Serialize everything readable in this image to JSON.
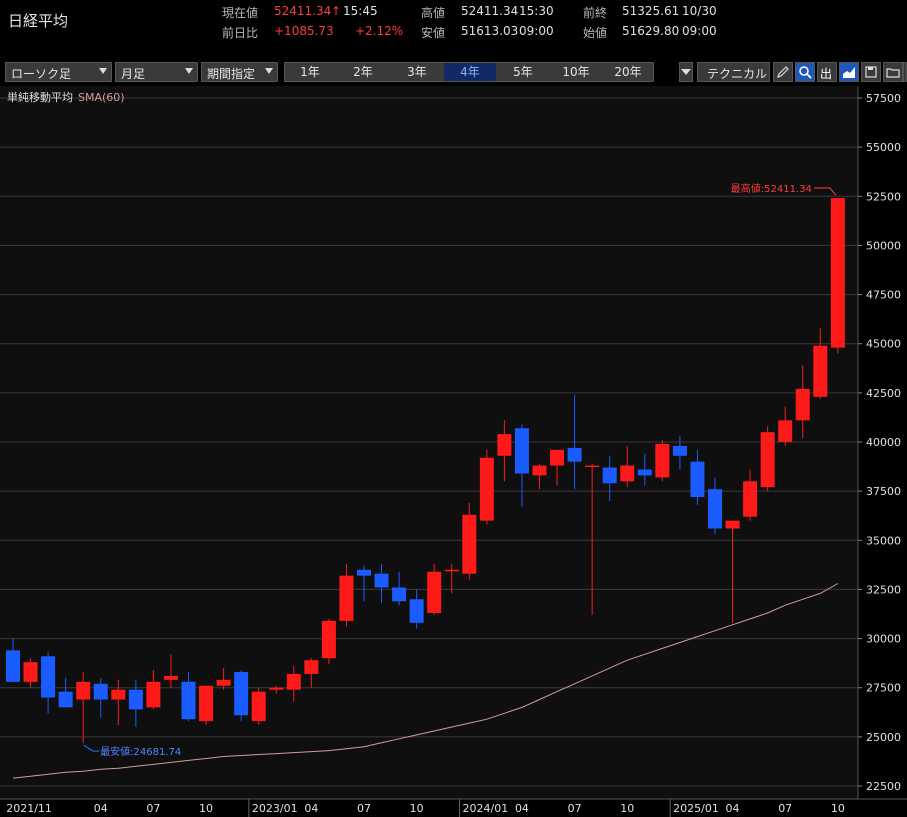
{
  "header": {
    "title": "日経平均",
    "current_label": "現在値",
    "current_value": "52411.34",
    "current_arrow": "↑",
    "current_time": "15:45",
    "high_label": "高値",
    "high_value": "52411.34",
    "high_time": "15:30",
    "prev_close_label": "前終",
    "prev_close_value": "51325.61",
    "prev_close_date": "10/30",
    "change_label": "前日比",
    "change_value": "+1085.73",
    "change_pct": "+2.12%",
    "low_label": "安値",
    "low_value": "51613.03",
    "low_time": "09:00",
    "open_label": "始値",
    "open_value": "51629.80",
    "open_time": "09:00"
  },
  "toolbar": {
    "chart_type": "ローソク足",
    "interval": "月足",
    "period_select": "期間指定",
    "periods": [
      "1年",
      "2年",
      "3年",
      "4年",
      "5年",
      "10年",
      "20年"
    ],
    "active_period": "4年",
    "technical": "テクニカル",
    "out_label": "出",
    "icons": [
      "dropdown-icon",
      "pencil-icon",
      "zoom-icon",
      "output-icon",
      "area-chart-icon",
      "save-icon",
      "folder-icon",
      "new-window-icon"
    ]
  },
  "colors": {
    "up": "#ff1a1a",
    "down": "#1a5cff",
    "sma": "#d89a9a",
    "grid": "#3a3a3a",
    "accent": "#1f58b8"
  },
  "chart_data": {
    "type": "candlestick",
    "indicator_label": "単純移動平均",
    "sma_label": "SMA(60)",
    "ylim": [
      22500,
      57500
    ],
    "y_ticks": [
      22500,
      25000,
      27500,
      30000,
      32500,
      35000,
      37500,
      40000,
      42500,
      45000,
      47500,
      50000,
      52500,
      55000,
      57500
    ],
    "x_labels": [
      "2021/11",
      "04",
      "07",
      "10",
      "2023/01",
      "04",
      "07",
      "10",
      "2024/01",
      "04",
      "07",
      "10",
      "2025/01",
      "04",
      "07",
      "10"
    ],
    "x_label_index": [
      0,
      5,
      8,
      11,
      14,
      17,
      20,
      23,
      26,
      29,
      32,
      35,
      38,
      41,
      44,
      47
    ],
    "max_annotation": "最高値:52411.34",
    "max_index": 47,
    "max_value": 52411.34,
    "min_annotation": "最安値:24681.74",
    "min_index": 4,
    "min_value": 24681.74,
    "candles": [
      {
        "o": 29400,
        "h": 30000,
        "l": 27800,
        "c": 27800
      },
      {
        "o": 27800,
        "h": 29000,
        "l": 27500,
        "c": 28800
      },
      {
        "o": 29100,
        "h": 29300,
        "l": 26200,
        "c": 27000
      },
      {
        "o": 27300,
        "h": 28000,
        "l": 26500,
        "c": 26500
      },
      {
        "o": 26900,
        "h": 28300,
        "l": 24681.74,
        "c": 27800
      },
      {
        "o": 27700,
        "h": 28000,
        "l": 26000,
        "c": 26900
      },
      {
        "o": 26900,
        "h": 27900,
        "l": 25600,
        "c": 27400
      },
      {
        "o": 27400,
        "h": 27900,
        "l": 25500,
        "c": 26400
      },
      {
        "o": 26500,
        "h": 28400,
        "l": 26400,
        "c": 27800
      },
      {
        "o": 27900,
        "h": 29200,
        "l": 27500,
        "c": 28100
      },
      {
        "o": 27800,
        "h": 28300,
        "l": 25800,
        "c": 25900
      },
      {
        "o": 25800,
        "h": 27600,
        "l": 25600,
        "c": 27600
      },
      {
        "o": 27600,
        "h": 28500,
        "l": 27400,
        "c": 27900
      },
      {
        "o": 28300,
        "h": 28400,
        "l": 25800,
        "c": 26100
      },
      {
        "o": 25800,
        "h": 27500,
        "l": 25600,
        "c": 27300
      },
      {
        "o": 27400,
        "h": 27600,
        "l": 27200,
        "c": 27500
      },
      {
        "o": 27400,
        "h": 28600,
        "l": 26800,
        "c": 28200
      },
      {
        "o": 28200,
        "h": 29000,
        "l": 27500,
        "c": 28900
      },
      {
        "o": 29000,
        "h": 31000,
        "l": 28700,
        "c": 30900
      },
      {
        "o": 30900,
        "h": 33800,
        "l": 30600,
        "c": 33200
      },
      {
        "o": 33500,
        "h": 33700,
        "l": 31900,
        "c": 33200
      },
      {
        "o": 33300,
        "h": 33800,
        "l": 31800,
        "c": 32600
      },
      {
        "o": 32600,
        "h": 33400,
        "l": 31700,
        "c": 31900
      },
      {
        "o": 32000,
        "h": 32500,
        "l": 30500,
        "c": 30800
      },
      {
        "o": 31300,
        "h": 33800,
        "l": 31200,
        "c": 33400
      },
      {
        "o": 33500,
        "h": 33800,
        "l": 32300,
        "c": 33500
      },
      {
        "o": 33300,
        "h": 36900,
        "l": 33000,
        "c": 36300
      },
      {
        "o": 36000,
        "h": 39600,
        "l": 35800,
        "c": 39200
      },
      {
        "o": 39300,
        "h": 41100,
        "l": 38000,
        "c": 40400
      },
      {
        "o": 40700,
        "h": 40900,
        "l": 36700,
        "c": 38400
      },
      {
        "o": 38300,
        "h": 38900,
        "l": 37600,
        "c": 38800
      },
      {
        "o": 38800,
        "h": 39400,
        "l": 37800,
        "c": 39600
      },
      {
        "o": 39700,
        "h": 42400,
        "l": 37600,
        "c": 39000
      },
      {
        "o": 38800,
        "h": 38900,
        "l": 31200,
        "c": 38800
      },
      {
        "o": 38700,
        "h": 39300,
        "l": 37000,
        "c": 37900
      },
      {
        "o": 38000,
        "h": 39800,
        "l": 37700,
        "c": 38800
      },
      {
        "o": 38600,
        "h": 39400,
        "l": 37800,
        "c": 38300
      },
      {
        "o": 38200,
        "h": 40100,
        "l": 38000,
        "c": 39900
      },
      {
        "o": 39800,
        "h": 40300,
        "l": 38600,
        "c": 39300
      },
      {
        "o": 39000,
        "h": 39600,
        "l": 36800,
        "c": 37200
      },
      {
        "o": 37600,
        "h": 38200,
        "l": 35300,
        "c": 35600
      },
      {
        "o": 35600,
        "h": 36000,
        "l": 30800,
        "c": 36000
      },
      {
        "o": 36200,
        "h": 38600,
        "l": 36000,
        "c": 38000
      },
      {
        "o": 37700,
        "h": 40800,
        "l": 37500,
        "c": 40500
      },
      {
        "o": 40000,
        "h": 41800,
        "l": 39800,
        "c": 41100
      },
      {
        "o": 41100,
        "h": 43900,
        "l": 40200,
        "c": 42700
      },
      {
        "o": 42300,
        "h": 45800,
        "l": 42200,
        "c": 44900
      },
      {
        "o": 44800,
        "h": 52411.34,
        "l": 44500,
        "c": 52411.34
      }
    ],
    "sma": [
      22900,
      23000,
      23100,
      23200,
      23250,
      23350,
      23400,
      23500,
      23600,
      23700,
      23800,
      23900,
      24000,
      24050,
      24100,
      24150,
      24200,
      24250,
      24300,
      24400,
      24500,
      24700,
      24900,
      25100,
      25300,
      25500,
      25700,
      25900,
      26200,
      26500,
      26900,
      27300,
      27700,
      28100,
      28500,
      28900,
      29200,
      29500,
      29800,
      30100,
      30400,
      30700,
      31000,
      31300,
      31700,
      32000,
      32300,
      32800
    ]
  }
}
